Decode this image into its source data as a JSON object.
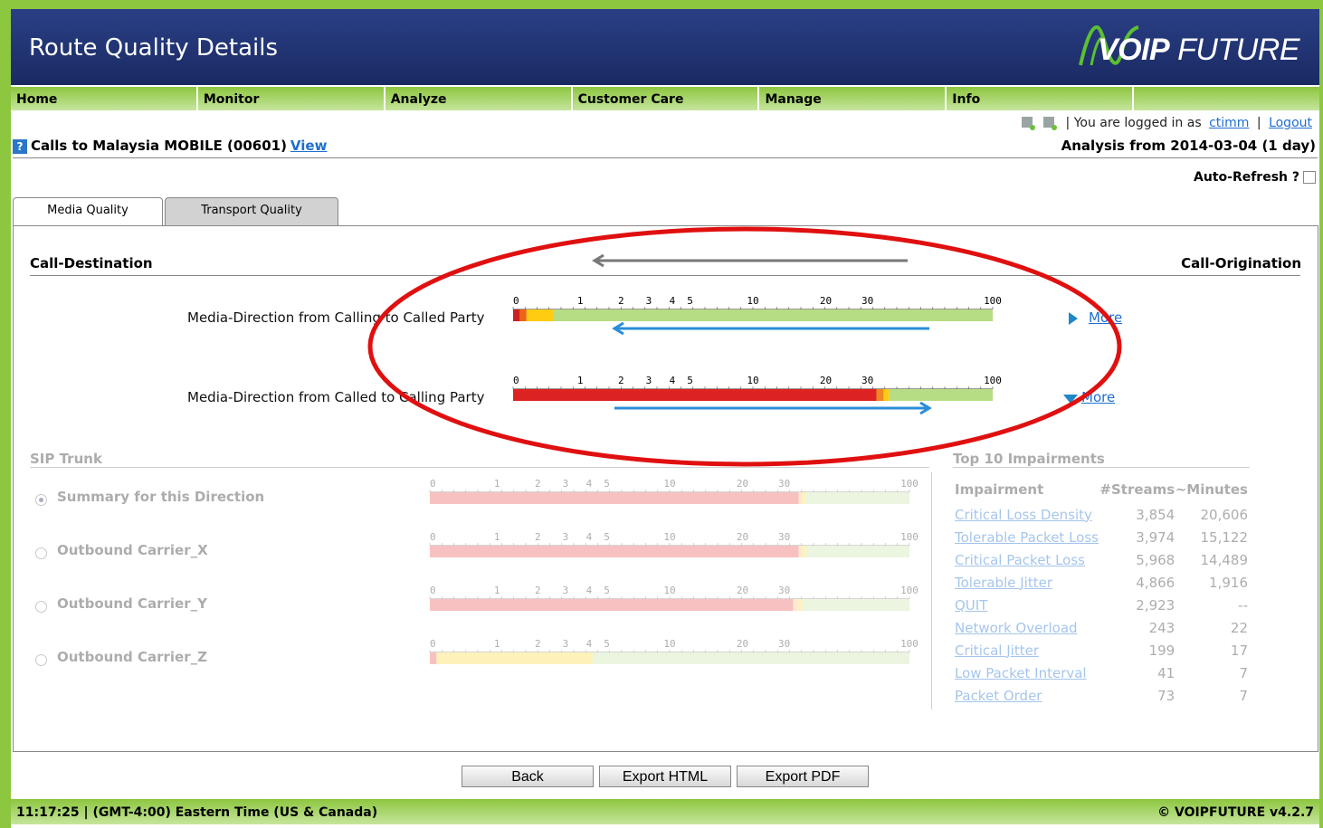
{
  "header": {
    "title": "Route Quality Details",
    "logo": {
      "bold": "VOIP",
      "rest": " FUTURE"
    }
  },
  "nav": [
    {
      "label": "Home"
    },
    {
      "label": "Monitor"
    },
    {
      "label": "Analyze"
    },
    {
      "label": "Customer Care"
    },
    {
      "label": "Manage"
    },
    {
      "label": "Info"
    },
    {
      "label": ""
    }
  ],
  "user": {
    "logged_in_text": "You are logged in as",
    "username": "ctimm",
    "separator": "|",
    "logout": "Logout"
  },
  "call": {
    "title": "Calls to Malaysia MOBILE (00601)",
    "view_link": "View",
    "help": "?",
    "analysis": "Analysis from 2014-03-04 (1 day)"
  },
  "auto_refresh": {
    "label": "Auto-Refresh ?",
    "checked": false
  },
  "tabs": [
    {
      "label": "Media Quality",
      "active": true
    },
    {
      "label": "Transport Quality",
      "active": false
    }
  ],
  "media": {
    "destination_label": "Call-Destination",
    "origination_label": "Call-Origination",
    "directions": [
      {
        "label": "Media-Direction from Calling to Called Party",
        "more": "More",
        "segments": [
          {
            "from": 0,
            "to": 0.1,
            "color": "#cc2222"
          },
          {
            "from": 0.1,
            "to": 0.2,
            "color": "#ee6611"
          },
          {
            "from": 0.2,
            "to": 0.6,
            "color": "#ffcc11"
          },
          {
            "from": 0.6,
            "to": 100,
            "color": "#b7dd84"
          }
        ]
      },
      {
        "label": "Media-Direction from Called to Calling Party",
        "more": "More",
        "segments": [
          {
            "from": 0,
            "to": 35,
            "color": "#dd2222"
          },
          {
            "from": 35,
            "to": 39,
            "color": "#ee8822"
          },
          {
            "from": 39,
            "to": 42,
            "color": "#ffcc11"
          },
          {
            "from": 42,
            "to": 100,
            "color": "#b7dd84"
          }
        ]
      }
    ]
  },
  "sip_trunk": {
    "title": "SIP Trunk",
    "rows": [
      {
        "label": "Summary for this Direction",
        "selected": true,
        "segments": [
          {
            "from": 0,
            "to": 38,
            "color": "#ee6666"
          },
          {
            "from": 38,
            "to": 40,
            "color": "#ffcc88"
          },
          {
            "from": 40,
            "to": 42,
            "color": "#ffdd55"
          },
          {
            "from": 42,
            "to": 100,
            "color": "#cfe8b0"
          }
        ]
      },
      {
        "label": "Outbound Carrier_X",
        "selected": false,
        "segments": [
          {
            "from": 0,
            "to": 38,
            "color": "#ee6666"
          },
          {
            "from": 38,
            "to": 40,
            "color": "#ffcc88"
          },
          {
            "from": 40,
            "to": 42,
            "color": "#ffdd55"
          },
          {
            "from": 42,
            "to": 100,
            "color": "#cfe8b0"
          }
        ]
      },
      {
        "label": "Outbound Carrier_Y",
        "selected": false,
        "segments": [
          {
            "from": 0,
            "to": 35,
            "color": "#ee6666"
          },
          {
            "from": 35,
            "to": 38,
            "color": "#ffcc88"
          },
          {
            "from": 38,
            "to": 40,
            "color": "#ffdd55"
          },
          {
            "from": 40,
            "to": 100,
            "color": "#cfe8b0"
          }
        ]
      },
      {
        "label": "Outbound Carrier_Z",
        "selected": false,
        "segments": [
          {
            "from": 0,
            "to": 0.1,
            "color": "#ee6666"
          },
          {
            "from": 0.1,
            "to": 4.2,
            "color": "#ffdd55"
          },
          {
            "from": 4.2,
            "to": 100,
            "color": "#cfe8b0"
          }
        ]
      }
    ]
  },
  "scale_ticks": [
    "0",
    "1",
    "2",
    "3",
    "4",
    "5",
    "10",
    "20",
    "30",
    "100"
  ],
  "impairments": {
    "title": "Top 10 Impairments",
    "headers": {
      "name": "Impairment",
      "streams": "#Streams",
      "minutes": "~Minutes"
    },
    "rows": [
      {
        "name": "Critical Loss Density",
        "streams": "3,854",
        "minutes": "20,606"
      },
      {
        "name": "Tolerable Packet Loss",
        "streams": "3,974",
        "minutes": "15,122"
      },
      {
        "name": "Critical Packet Loss",
        "streams": "5,968",
        "minutes": "14,489"
      },
      {
        "name": "Tolerable Jitter",
        "streams": "4,866",
        "minutes": "1,916"
      },
      {
        "name": "QUIT",
        "streams": "2,923",
        "minutes": "--"
      },
      {
        "name": "Network Overload",
        "streams": "243",
        "minutes": "22"
      },
      {
        "name": "Critical Jitter",
        "streams": "199",
        "minutes": "17"
      },
      {
        "name": "Low Packet Interval",
        "streams": "41",
        "minutes": "7"
      },
      {
        "name": "Packet Order",
        "streams": "73",
        "minutes": "7"
      }
    ]
  },
  "buttons": {
    "back": "Back",
    "export_html": "Export HTML",
    "export_pdf": "Export PDF"
  },
  "footer": {
    "time": "11:17:25 | (GMT-4:00) Eastern Time (US & Canada)",
    "version": "© VOIPFUTURE v4.2.7"
  },
  "colors": {
    "header_bg": "#1a2a62",
    "nav_green": "#8dc63f",
    "link_blue": "#1e6fd0",
    "annotation_red": "#e01010",
    "arrow_blue": "#2a8ed8",
    "arrow_gray": "#777777"
  },
  "icons": {
    "logo": "voipfuture-wave-logo",
    "help": "question-mark-icon",
    "status": [
      "green-status-icon",
      "gray-status-icon"
    ],
    "more": "triangle-expander-icon"
  }
}
